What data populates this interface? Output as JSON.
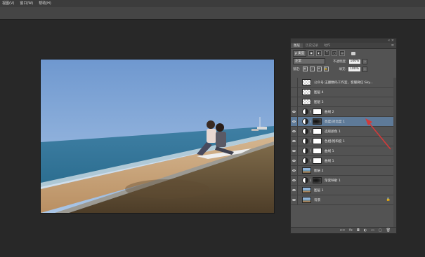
{
  "menu": [
    "视图(V)",
    "窗口(W)",
    "帮助(H)"
  ],
  "panel": {
    "tabs": [
      "图层",
      "历史记录",
      "动作"
    ],
    "filter_label": "ρ 类型",
    "blend_mode": "正常",
    "opacity_label": "不透明度:",
    "opacity_value": "100%",
    "lock_label": "锁定:",
    "fill_label": "填充:",
    "fill_value": "100%",
    "layers": [
      {
        "name": "公众号:王翻数码工作室，客服微信:Sky...",
        "eye": false,
        "kind": "checker"
      },
      {
        "name": "图层 4",
        "eye": false,
        "kind": "checker"
      },
      {
        "name": "图层 3",
        "eye": false,
        "kind": "checker"
      },
      {
        "name": "曲线 2",
        "eye": true,
        "kind": "adjust"
      },
      {
        "name": "亮度/对比度 1",
        "eye": true,
        "kind": "adjust-dark",
        "selected": true
      },
      {
        "name": "选取颜色 1",
        "eye": true,
        "kind": "adjust"
      },
      {
        "name": "色相/饱和度 1",
        "eye": true,
        "kind": "adjust"
      },
      {
        "name": "曲线 1",
        "eye": true,
        "kind": "adjust"
      },
      {
        "name": "曲线 1",
        "eye": true,
        "kind": "adjust"
      },
      {
        "name": "图层 2",
        "eye": true,
        "kind": "photo"
      },
      {
        "name": "渐变映射 1",
        "eye": true,
        "kind": "adjust-dark"
      },
      {
        "name": "图层 1",
        "eye": true,
        "kind": "photo"
      },
      {
        "name": "背景",
        "eye": true,
        "kind": "photo",
        "locked": true
      }
    ],
    "bottom_icons": [
      "link-icon",
      "fx-icon",
      "mask-icon",
      "adjustment-icon",
      "folder-icon",
      "new-layer-icon",
      "trash-icon"
    ],
    "bottom_glyphs": [
      "ⅽ⊃",
      "fx",
      "◘",
      "◐",
      "▭",
      "▢",
      "🗑"
    ]
  },
  "colors": {
    "selected": "#5e7a98",
    "annotation": "#d23a3a"
  }
}
